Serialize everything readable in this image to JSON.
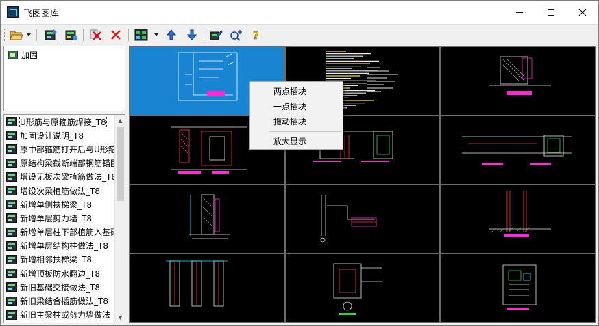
{
  "window": {
    "title": "飞图图库",
    "controls": [
      "minimize",
      "maximize",
      "close"
    ]
  },
  "toolbar": {
    "buttons": [
      {
        "name": "open-folder-button",
        "icon": "open-folder-icon"
      },
      {
        "name": "import-button",
        "icon": "library-import-icon"
      },
      {
        "name": "export-button",
        "icon": "library-export-icon"
      },
      {
        "name": "cut-button",
        "icon": "cut-x-icon"
      },
      {
        "name": "delete-button",
        "icon": "delete-x-icon"
      },
      {
        "name": "view-mode-button",
        "icon": "grid-view-icon"
      },
      {
        "name": "move-up-button",
        "icon": "arrow-up-icon"
      },
      {
        "name": "move-down-button",
        "icon": "arrow-down-icon"
      },
      {
        "name": "edit-button",
        "icon": "edit-block-icon"
      },
      {
        "name": "search-button",
        "icon": "search-plus-icon"
      },
      {
        "name": "help-button",
        "icon": "help-question-icon"
      }
    ]
  },
  "tree": {
    "items": [
      {
        "label": "加固"
      }
    ]
  },
  "list": {
    "items": [
      {
        "label": "U形筋与原箍筋焊接_T8",
        "selected": true
      },
      {
        "label": "加固设计说明_T8"
      },
      {
        "label": "原中部箍筋打开后与U形箍"
      },
      {
        "label": "原结构梁截断端部钢筋锚固"
      },
      {
        "label": "增设无板次梁植筋做法_T8"
      },
      {
        "label": "增设次梁植筋做法_T8"
      },
      {
        "label": "新增单侧扶梯梁_T8"
      },
      {
        "label": "新增单层剪力墙_T8"
      },
      {
        "label": "新增单层柱下部植筋入基础"
      },
      {
        "label": "新增单层结构柱做法_T8"
      },
      {
        "label": "新增相邻扶梯梁_T8"
      },
      {
        "label": "新增顶板防水翻边_T8"
      },
      {
        "label": "新旧基础交接做法_T8"
      },
      {
        "label": "新旧梁结合插筋做法_T8"
      },
      {
        "label": "新旧主梁柱或剪力墙做法"
      }
    ]
  },
  "context_menu": {
    "items": [
      "两点插块",
      "一点插块",
      "拖动插块",
      "放大显示"
    ]
  },
  "thumbnails": {
    "count": 12,
    "selected_index": 0,
    "background": "#000000",
    "selected_background": "#1985d2"
  },
  "colors": {
    "cad_white": "#e8e8e8",
    "cad_red": "#ff3b3b",
    "cad_magenta": "#ff2bd6",
    "cad_green": "#35d24a",
    "cad_cyan": "#3fe0ff",
    "cad_yellow": "#f2e23a"
  }
}
